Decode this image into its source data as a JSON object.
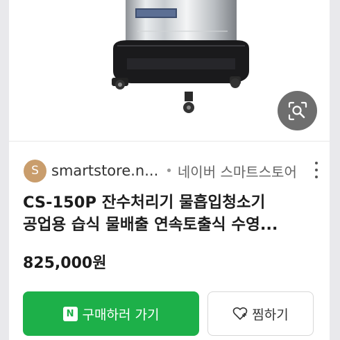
{
  "source": {
    "favicon_letter": "S",
    "domain": "smartstore.n...",
    "separator": "•",
    "store_name": "네이버 스마트스토어"
  },
  "product": {
    "title_line1": "CS-150P 잔수처리기 물흡입청소기",
    "title_line2": "공업용 습식 물배출 연속토출식 수영...",
    "price": "825,000원"
  },
  "actions": {
    "buy_badge": "N",
    "buy_label": "구매하러 가기",
    "wish_label": "찜하기"
  },
  "colors": {
    "buy_green": "#1db049",
    "favicon_bg": "#c99d6c"
  },
  "icons": [
    "image-search-icon",
    "more-vert-icon",
    "naver-n-icon",
    "heart-plus-icon"
  ]
}
